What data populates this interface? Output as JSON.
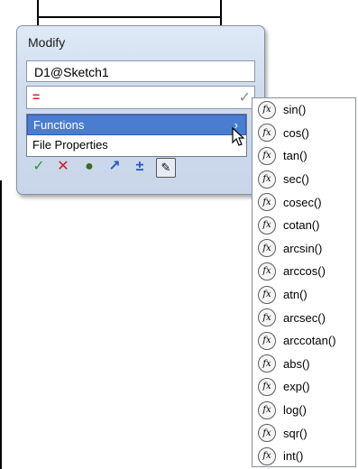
{
  "dialog": {
    "title": "Modify",
    "name_value": "D1@Sketch1",
    "expression_value": "=",
    "check_glyph": "✓"
  },
  "expression_menu": {
    "items": [
      {
        "label": "Functions",
        "selected": true,
        "submenu_arrow": "›"
      },
      {
        "label": "File Properties",
        "selected": false,
        "submenu_arrow": ""
      }
    ]
  },
  "toolbar": {
    "icons": [
      "ok-check-icon",
      "cancel-x-icon",
      "rebuild-icon",
      "reverse-dimension-icon",
      "regenerate-icon",
      "mark-dimension-icon"
    ]
  },
  "functions_menu": {
    "items": [
      "sin()",
      "cos()",
      "tan()",
      "sec()",
      "cosec()",
      "cotan()",
      "arcsin()",
      "arccos()",
      "atn()",
      "arcsec()",
      "arccotan()",
      "abs()",
      "exp()",
      "log()",
      "sqr()",
      "int()"
    ]
  },
  "colors": {
    "accent": "#4a7dd0",
    "expression_text": "#e0202a"
  }
}
